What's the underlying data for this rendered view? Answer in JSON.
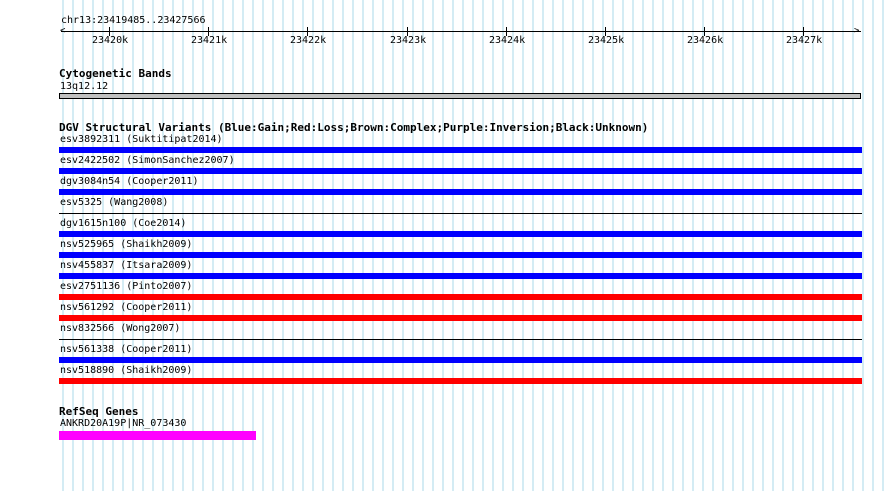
{
  "ruler": {
    "location": "chr13:23419485..23427566",
    "ticks": [
      "23420k",
      "23421k",
      "23422k",
      "23423k",
      "23424k",
      "23425k",
      "23426k",
      "23427k"
    ]
  },
  "cytobands": {
    "title": "Cytogenetic Bands",
    "band": "13q12.12",
    "band_color": "#c0c0c0"
  },
  "dgv": {
    "title": "DGV Structural Variants (Blue:Gain;Red:Loss;Brown:Complex;Purple:Inversion;Black:Unknown)",
    "variants": [
      {
        "label": "esv3892311 (Suktitipat2014)",
        "color": "#0000ff"
      },
      {
        "label": "esv2422502 (SimonSanchez2007)",
        "color": "#0000ff"
      },
      {
        "label": "dgv3084n54 (Cooper2011)",
        "color": "#0000ff"
      },
      {
        "label": "esv5325 (Wang2008)",
        "color": "none"
      },
      {
        "label": "dgv1615n100 (Coe2014)",
        "color": "#0000ff"
      },
      {
        "label": "nsv525965 (Shaikh2009)",
        "color": "#0000ff"
      },
      {
        "label": "nsv455837 (Itsara2009)",
        "color": "#0000ff"
      },
      {
        "label": "esv2751136 (Pinto2007)",
        "color": "#ff0000"
      },
      {
        "label": "nsv561292 (Cooper2011)",
        "color": "#ff0000"
      },
      {
        "label": "nsv832566 (Wong2007)",
        "color": "none"
      },
      {
        "label": "nsv561338 (Cooper2011)",
        "color": "#0000ff"
      },
      {
        "label": "nsv518890 (Shaikh2009)",
        "color": "#ff0000"
      }
    ]
  },
  "refseq": {
    "title": "RefSeq Genes",
    "gene": "ANKRD20A19P|NR_073430",
    "gene_color": "#ff00ff"
  },
  "colors": {
    "gridline": "#a8d8e8",
    "gain": "#0000ff",
    "loss": "#ff0000",
    "gene": "#ff00ff"
  }
}
